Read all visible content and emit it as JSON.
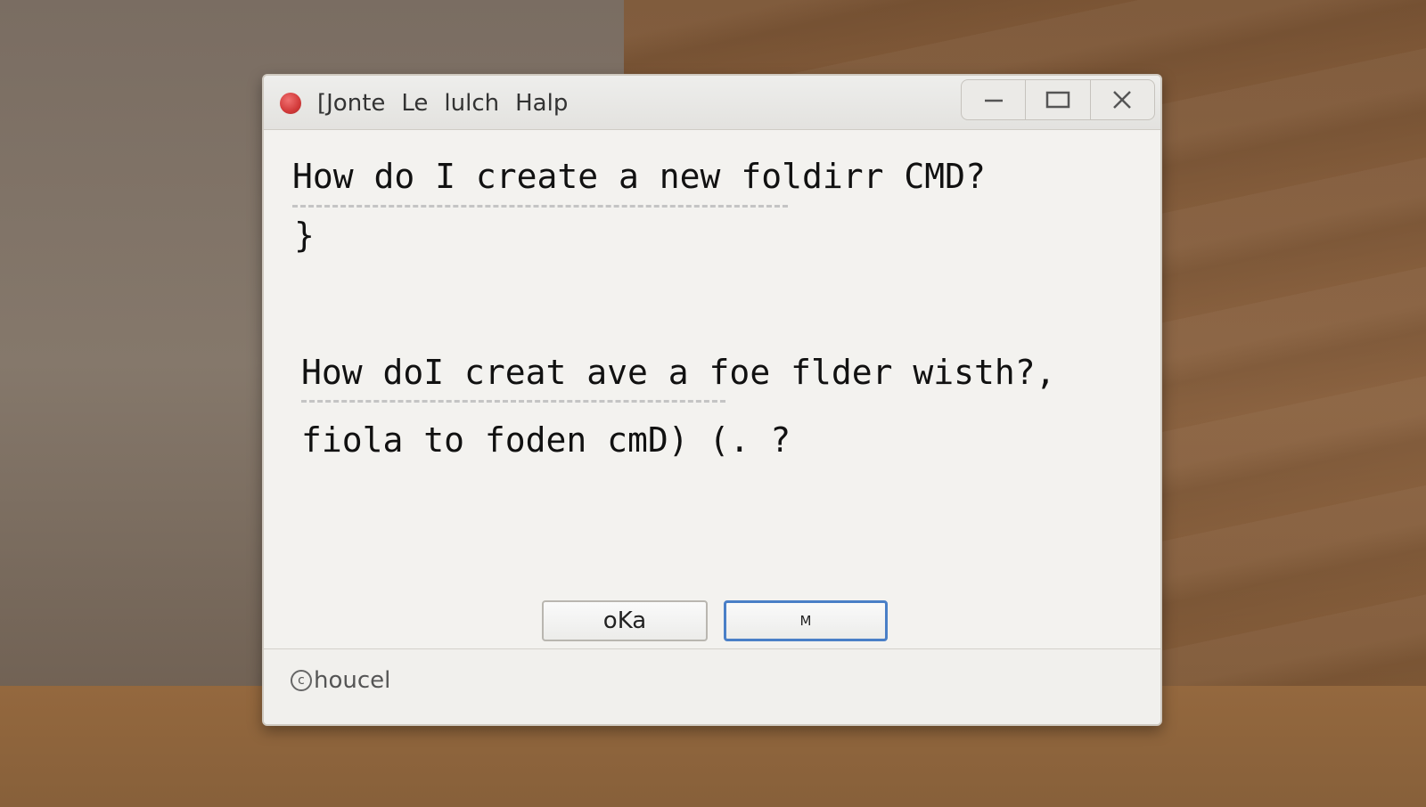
{
  "window": {
    "menu": [
      "[Jonte",
      "Le",
      "lulch",
      "Halp"
    ],
    "controls": {
      "minimize_icon": "minimize-icon",
      "maximize_icon": "maximize-icon",
      "close_icon": "close-icon"
    }
  },
  "content": {
    "question_1": "How do I create a new foldirr CMD?",
    "brace": "}",
    "question_2": "How doI creat ave a foe flder wisth?,",
    "question_3": "fiola to foden  cmD) (.  ?"
  },
  "buttons": {
    "ok_label": "oKa",
    "second_label": "M"
  },
  "footer": {
    "icon_glyph": "c",
    "text": "houcel"
  },
  "colors": {
    "close_dot": "#d23a3a",
    "focus_border": "#4a7fc7"
  }
}
